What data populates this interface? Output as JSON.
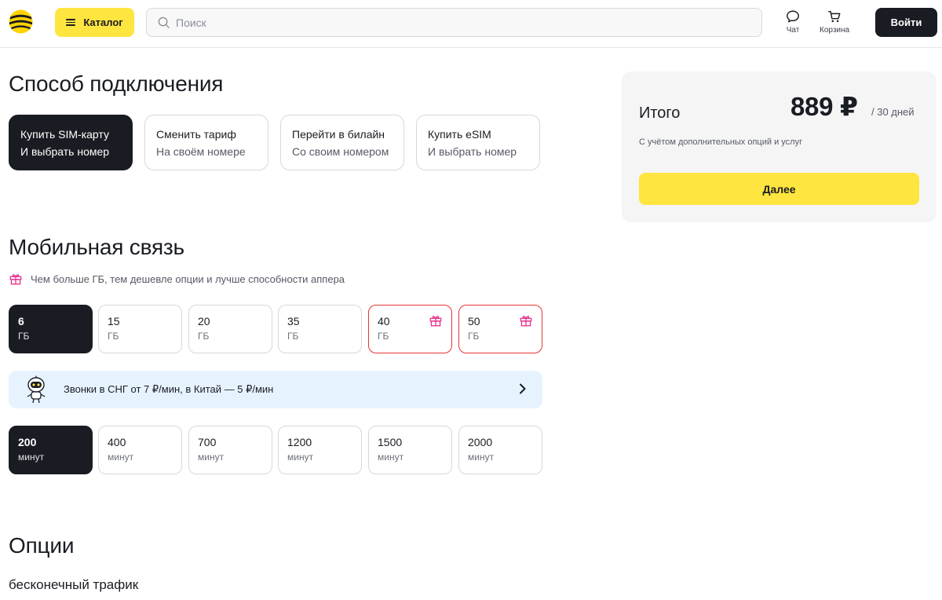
{
  "header": {
    "catalog_label": "Каталог",
    "search_placeholder": "Поиск",
    "chat_label": "Чат",
    "cart_label": "Корзина",
    "login_label": "Войти",
    "brand_colors": {
      "yellow": "#ffe53f",
      "dark": "#191c22"
    }
  },
  "connection": {
    "title": "Способ подключения",
    "options": [
      {
        "line1": "Купить SIM-карту",
        "line2": "И выбрать номер",
        "selected": true
      },
      {
        "line1": "Сменить тариф",
        "line2": "На своём номере",
        "selected": false
      },
      {
        "line1": "Перейти в билайн",
        "line2": "Со своим номером",
        "selected": false
      },
      {
        "line1": "Купить eSIM",
        "line2": "И выбрать номер",
        "selected": false
      }
    ]
  },
  "mobile": {
    "title": "Мобильная связь",
    "hint": "Чем больше ГБ, тем дешевле опции и лучше способности аппера",
    "gb_unit": "ГБ",
    "gb_options": [
      {
        "value": "6",
        "selected": true,
        "gift": false
      },
      {
        "value": "15",
        "selected": false,
        "gift": false
      },
      {
        "value": "20",
        "selected": false,
        "gift": false
      },
      {
        "value": "35",
        "selected": false,
        "gift": false
      },
      {
        "value": "40",
        "selected": false,
        "gift": true
      },
      {
        "value": "50",
        "selected": false,
        "gift": true
      }
    ],
    "banner_text": "Звонки в СНГ от 7 ₽/мин, в Китай — 5 ₽/мин",
    "minutes_unit": "минут",
    "minutes_options": [
      {
        "value": "200",
        "selected": true
      },
      {
        "value": "400",
        "selected": false
      },
      {
        "value": "700",
        "selected": false
      },
      {
        "value": "1200",
        "selected": false
      },
      {
        "value": "1500",
        "selected": false
      },
      {
        "value": "2000",
        "selected": false
      }
    ],
    "gift_color": "#e6338f",
    "gift_border_color": "#e63535"
  },
  "options": {
    "title": "Опции",
    "subtitle": "бесконечный трафик"
  },
  "summary": {
    "title": "Итого",
    "price": "889 ₽",
    "period": "/ 30 дней",
    "note": "С учётом дополнительных опций и услуг",
    "next_label": "Далее"
  }
}
